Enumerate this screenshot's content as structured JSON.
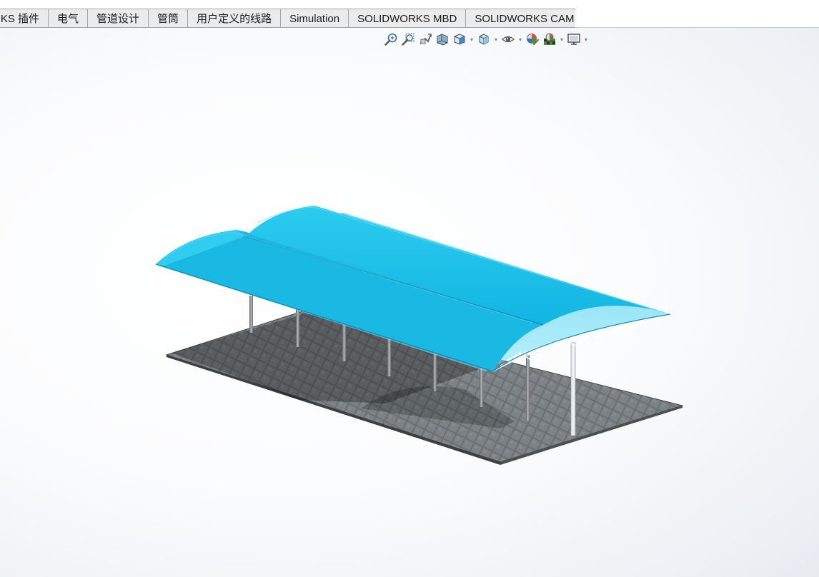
{
  "tabs": [
    {
      "label": "RKS 插件"
    },
    {
      "label": "电气"
    },
    {
      "label": "管道设计"
    },
    {
      "label": "管筒"
    },
    {
      "label": "用户定义的线路"
    },
    {
      "label": "Simulation"
    },
    {
      "label": "SOLIDWORKS MBD"
    },
    {
      "label": "SOLIDWORKS CAM"
    }
  ],
  "heads_up_toolbar": [
    {
      "icon": "zoom-to-fit-icon"
    },
    {
      "icon": "zoom-to-area-icon"
    },
    {
      "icon": "previous-view-icon"
    },
    {
      "icon": "section-view-icon"
    },
    {
      "icon": "view-orientation-icon",
      "dropdown": true
    },
    {
      "icon": "display-style-icon",
      "dropdown": true
    },
    {
      "icon": "hide-show-items-icon",
      "dropdown": true
    },
    {
      "icon": "edit-appearance-icon"
    },
    {
      "icon": "apply-scene-icon",
      "dropdown": true
    },
    {
      "icon": "view-settings-icon",
      "dropdown": true
    }
  ],
  "colors": {
    "canopy": "#1bbde6",
    "canopy_dark": "#0f9fc9",
    "pavement": "#5d6366",
    "post": "#7a7d80",
    "tab_bg": "#ebebeb"
  }
}
